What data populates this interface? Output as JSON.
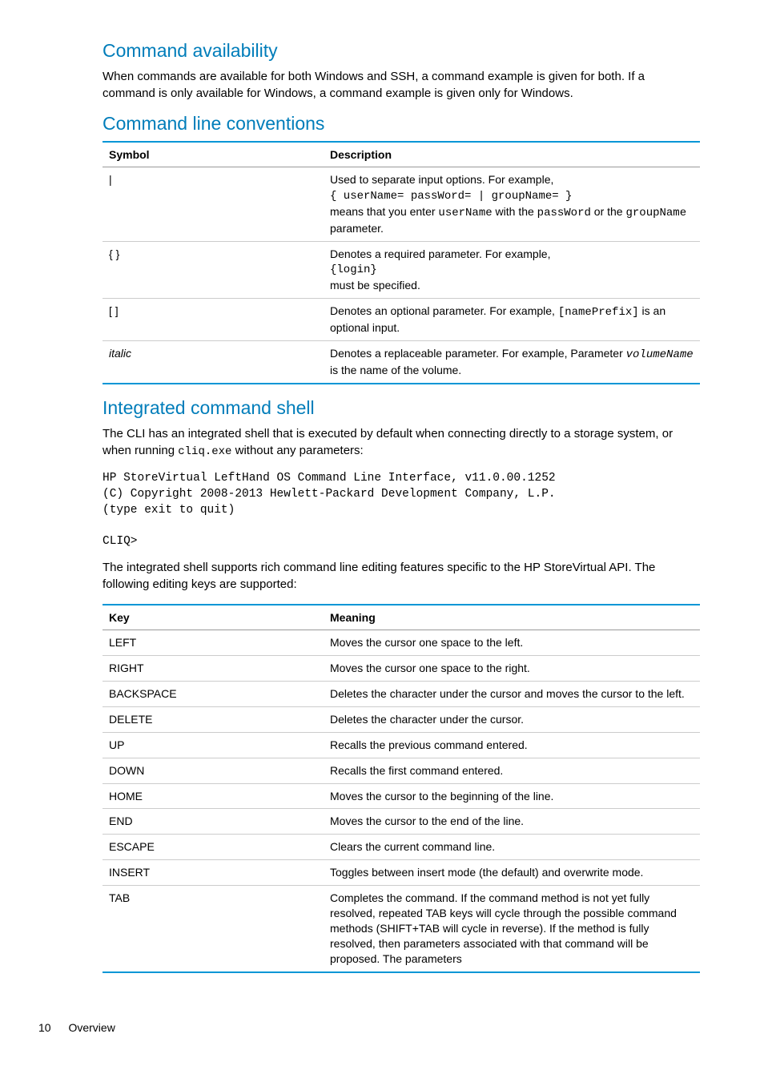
{
  "sections": {
    "s1_heading": "Command availability",
    "s1_para": "When commands are available for both Windows and SSH, a command example is given for both. If a command is only available for Windows, a command example is given only for Windows.",
    "s2_heading": "Command line conventions",
    "s3_heading": "Integrated command shell",
    "s3_para1_a": "The CLI has an integrated shell that is executed by default when connecting directly to a storage system, or when running ",
    "s3_para1_mono": "cliq.exe",
    "s3_para1_b": " without any parameters:",
    "s3_pre": "HP StoreVirtual LeftHand OS Command Line Interface, v11.0.00.1252\n(C) Copyright 2008-2013 Hewlett-Packard Development Company, L.P.\n(type exit to quit)\n\nCLIQ>",
    "s3_para2": "The integrated shell supports rich command line editing features specific to the HP StoreVirtual API. The following editing keys are supported:"
  },
  "table1": {
    "h1": "Symbol",
    "h2": "Description",
    "rows": [
      {
        "symbol": "|",
        "desc_a": "Used to separate input options. For example,",
        "desc_mono1": "{ userName= passWord= | groupName= }",
        "desc_b": "means that you enter ",
        "desc_mono2": "userName",
        "desc_c": " with the ",
        "desc_mono3": "passWord",
        "desc_d": " or the ",
        "desc_mono4": "groupName",
        "desc_e": " parameter."
      },
      {
        "symbol": "{ }",
        "desc_a": "Denotes a required parameter. For example,",
        "desc_mono1": "{login}",
        "desc_b": "must be specified."
      },
      {
        "symbol": "[ ]",
        "desc_a": "Denotes an optional parameter. For example, ",
        "desc_mono1": "[namePrefix]",
        "desc_b": " is an optional input."
      },
      {
        "symbol": "italic",
        "desc_a": "Denotes a replaceable parameter. For example, Parameter ",
        "desc_mono1": "volumeName",
        "desc_b": " is the name of the volume."
      }
    ]
  },
  "table2": {
    "h1": "Key",
    "h2": "Meaning",
    "rows": [
      {
        "k": "LEFT",
        "m": "Moves the cursor one space to the left."
      },
      {
        "k": "RIGHT",
        "m": "Moves the cursor one space to the right."
      },
      {
        "k": "BACKSPACE",
        "m": "Deletes the character under the cursor and moves the cursor to the left."
      },
      {
        "k": "DELETE",
        "m": "Deletes the character under the cursor."
      },
      {
        "k": "UP",
        "m": "Recalls the previous command entered."
      },
      {
        "k": "DOWN",
        "m": "Recalls the first command entered."
      },
      {
        "k": "HOME",
        "m": "Moves the cursor to the beginning of the line."
      },
      {
        "k": "END",
        "m": "Moves the cursor to the end of the line."
      },
      {
        "k": "ESCAPE",
        "m": "Clears the current command line."
      },
      {
        "k": "INSERT",
        "m": "Toggles between insert mode (the default) and overwrite mode."
      },
      {
        "k": "TAB",
        "m": "Completes the command. If the command method is not yet fully resolved, repeated TAB keys will cycle through the possible command methods (SHIFT+TAB will cycle in reverse). If the method is fully resolved, then parameters associated with that command will be proposed. The parameters"
      }
    ]
  },
  "footer": {
    "page_number": "10",
    "section": "Overview"
  }
}
